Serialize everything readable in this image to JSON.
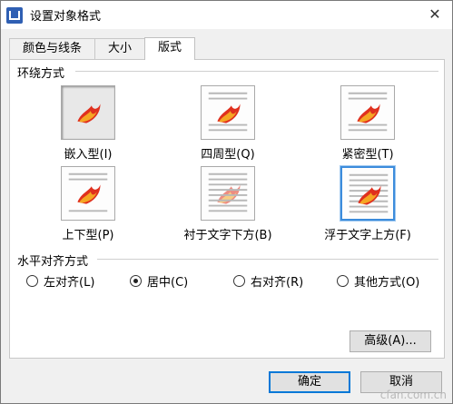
{
  "dialog": {
    "title": "设置对象格式",
    "close_glyph": "✕",
    "app_icon": "wps-writer-icon"
  },
  "tabs": [
    {
      "label": "颜色与线条",
      "active": false
    },
    {
      "label": "大小",
      "active": false
    },
    {
      "label": "版式",
      "active": true
    }
  ],
  "wrapping": {
    "group_title": "环绕方式",
    "items": [
      {
        "label": "嵌入型(I)",
        "selected": false
      },
      {
        "label": "四周型(Q)",
        "selected": false
      },
      {
        "label": "紧密型(T)",
        "selected": false
      },
      {
        "label": "上下型(P)",
        "selected": false
      },
      {
        "label": "衬于文字下方(B)",
        "selected": false
      },
      {
        "label": "浮于文字上方(F)",
        "selected": true
      }
    ]
  },
  "alignment": {
    "group_title": "水平对齐方式",
    "options": [
      {
        "label": "左对齐(L)",
        "checked": false
      },
      {
        "label": "居中(C)",
        "checked": true
      },
      {
        "label": "右对齐(R)",
        "checked": false
      },
      {
        "label": "其他方式(O)",
        "checked": false
      }
    ]
  },
  "buttons": {
    "advanced": "高级(A)...",
    "ok": "确定",
    "cancel": "取消"
  },
  "watermark": "cfan.com.cn",
  "colors": {
    "selected_border": "#3c8cdc",
    "default_button_border": "#0078d7",
    "flame_red": "#e0301e",
    "flame_orange": "#f5a623"
  }
}
